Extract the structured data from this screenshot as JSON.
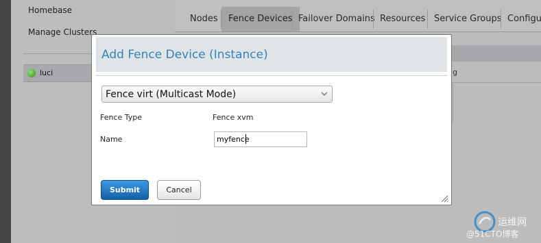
{
  "sidebar": {
    "links": [
      "Homebase",
      "Manage Clusters"
    ],
    "cluster": {
      "name": "luci",
      "status_color": "#3aa31a"
    }
  },
  "tabs": [
    {
      "label": "Nodes"
    },
    {
      "label": "Fence Devices"
    },
    {
      "label": "Failover Domains"
    },
    {
      "label": "Resources"
    },
    {
      "label": "Service Groups"
    },
    {
      "label": "Configur"
    }
  ],
  "background": {
    "truncated_text": "g"
  },
  "modal": {
    "title": "Add Fence Device (Instance)",
    "select": {
      "value": "Fence virt (Multicast Mode)",
      "icon": "chevron-down-icon"
    },
    "fields": {
      "fence_type_label": "Fence Type",
      "fence_type_value": "Fence xvm",
      "name_label": "Name",
      "name_value": "myfence"
    },
    "buttons": {
      "submit": "Submit",
      "cancel": "Cancel"
    },
    "accent": "#3283b9"
  },
  "watermark": {
    "site": "运维网",
    "blog": "@51CTO博客"
  }
}
